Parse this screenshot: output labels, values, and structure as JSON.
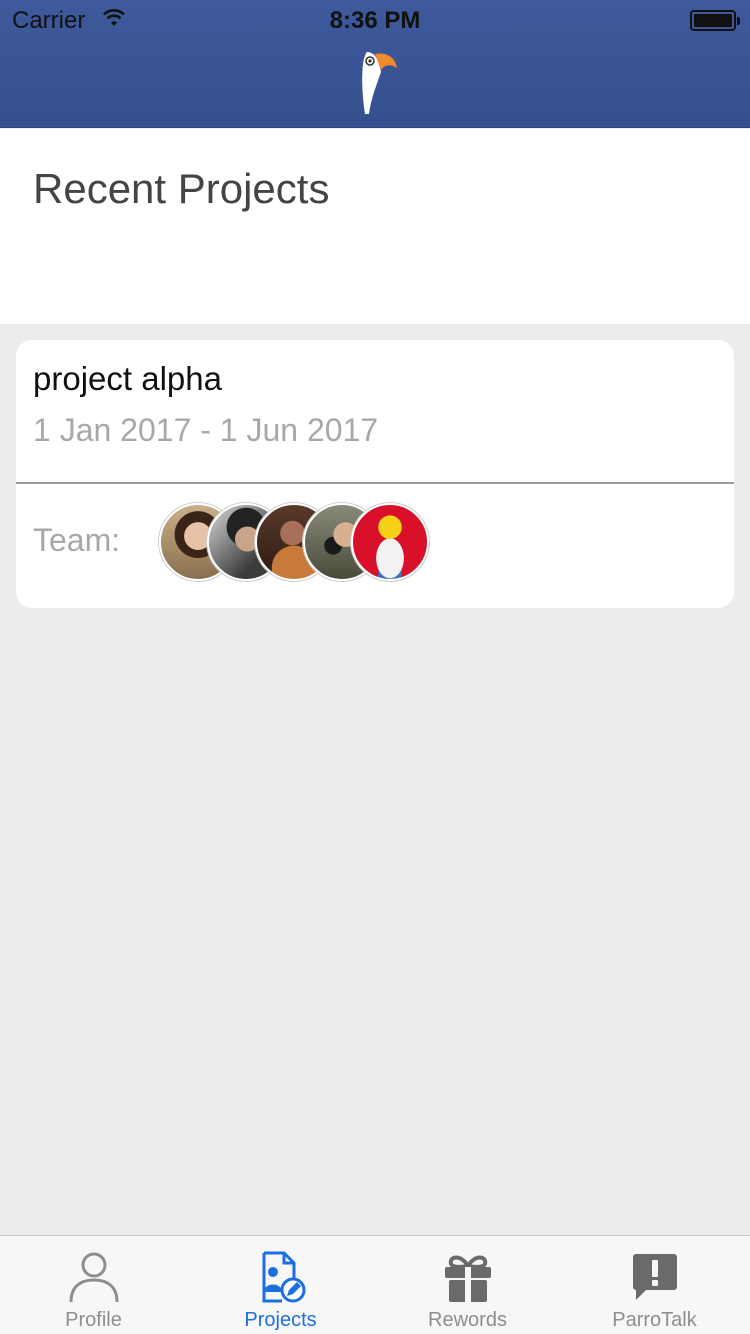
{
  "status_bar": {
    "carrier": "Carrier",
    "time": "8:36 PM"
  },
  "header": {
    "logo": "parrot-logo"
  },
  "page": {
    "title": "Recent Projects"
  },
  "project": {
    "name": "project alpha",
    "dates": "1 Jan 2017 - 1 Jun 2017",
    "team_label": "Team:",
    "team_avatars": [
      "avatar-1",
      "avatar-2",
      "avatar-3",
      "avatar-4",
      "avatar-5"
    ]
  },
  "tabbar": {
    "tabs": [
      {
        "label": "Profile",
        "icon": "person-icon",
        "active": false
      },
      {
        "label": "Projects",
        "icon": "projects-icon",
        "active": true
      },
      {
        "label": "Rewords",
        "icon": "gift-icon",
        "active": false
      },
      {
        "label": "ParroTalk",
        "icon": "chat-alert-icon",
        "active": false
      }
    ]
  },
  "colors": {
    "header": "#3a5595",
    "accent": "#1c6fe0",
    "inactive": "#8e8e8e",
    "background": "#ececec"
  }
}
